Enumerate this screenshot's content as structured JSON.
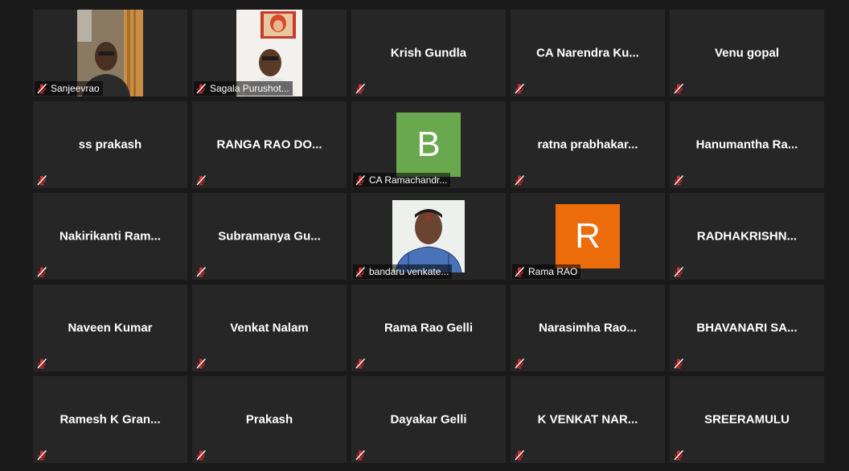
{
  "colors": {
    "background": "#1a1a1a",
    "tile": "#262626",
    "muted_mic": "#e02828",
    "avatar_b": "#6aa84f",
    "avatar_r": "#ec6b0b"
  },
  "participants": [
    {
      "name": "Sanjeevrao",
      "kind": "video-person",
      "muted": true
    },
    {
      "name": "Sagala Purushot...",
      "kind": "video-portrait",
      "muted": true
    },
    {
      "name": "Krish Gundla",
      "kind": "name",
      "muted": true
    },
    {
      "name": "CA Narendra Ku...",
      "kind": "name",
      "muted": true
    },
    {
      "name": "Venu gopal",
      "kind": "name",
      "muted": true
    },
    {
      "name": "ss prakash",
      "kind": "name",
      "muted": true
    },
    {
      "name": "RANGA RAO DO...",
      "kind": "name",
      "muted": true
    },
    {
      "name": "CA Ramachandr...",
      "kind": "avatar",
      "avatar_letter": "B",
      "avatar_color": "#6aa84f",
      "muted": true
    },
    {
      "name": "ratna  prabhakar...",
      "kind": "name",
      "muted": true
    },
    {
      "name": "Hanumantha  Ra...",
      "kind": "name",
      "muted": true
    },
    {
      "name": "Nakirikanti  Ram...",
      "kind": "name",
      "muted": true
    },
    {
      "name": "Subramanya  Gu...",
      "kind": "name",
      "muted": true
    },
    {
      "name": "bandaru venkate...",
      "kind": "video-photo",
      "muted": true
    },
    {
      "name": "Rama RAO",
      "kind": "avatar",
      "avatar_letter": "R",
      "avatar_color": "#ec6b0b",
      "muted": true
    },
    {
      "name": "RADHAKRISHN...",
      "kind": "name",
      "muted": true
    },
    {
      "name": "Naveen Kumar",
      "kind": "name",
      "muted": true
    },
    {
      "name": "Venkat Nalam",
      "kind": "name",
      "muted": true
    },
    {
      "name": "Rama Rao Gelli",
      "kind": "name",
      "muted": true
    },
    {
      "name": "Narasimha  Rao...",
      "kind": "name",
      "muted": true
    },
    {
      "name": "BHAVANARI  SA...",
      "kind": "name",
      "muted": true
    },
    {
      "name": "Ramesh K Gran...",
      "kind": "name",
      "muted": true
    },
    {
      "name": "Prakash",
      "kind": "name",
      "muted": true
    },
    {
      "name": "Dayakar Gelli",
      "kind": "name",
      "muted": true
    },
    {
      "name": "K VENKAT NAR...",
      "kind": "name",
      "muted": true
    },
    {
      "name": "SREERAMULU",
      "kind": "name",
      "muted": true
    }
  ]
}
